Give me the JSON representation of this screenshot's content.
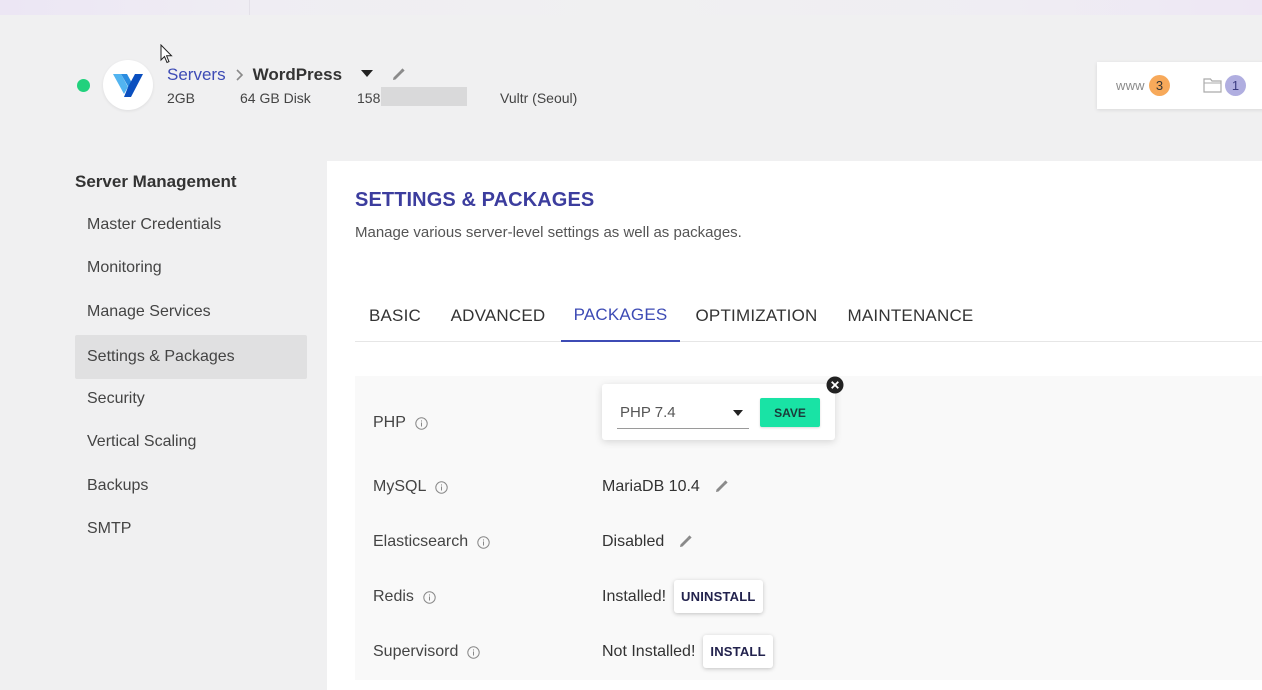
{
  "server": {
    "breadcrumb_root": "Servers",
    "name": "WordPress",
    "ram": "2GB",
    "disk": "64 GB Disk",
    "ip_prefix": "158.",
    "provider": "Vultr (Seoul)",
    "status_color": "#21d17d"
  },
  "top_widget": {
    "www_label": "www",
    "www_count": "3",
    "folder_count": "1"
  },
  "sidebar": {
    "title": "Server Management",
    "items": [
      {
        "label": "Master Credentials"
      },
      {
        "label": "Monitoring"
      },
      {
        "label": "Manage Services"
      },
      {
        "label": "Settings & Packages",
        "active": true
      },
      {
        "label": "Security"
      },
      {
        "label": "Vertical Scaling"
      },
      {
        "label": "Backups"
      },
      {
        "label": "SMTP"
      }
    ]
  },
  "page": {
    "title": "SETTINGS & PACKAGES",
    "subtitle": "Manage various server-level settings as well as packages."
  },
  "tabs": [
    {
      "label": "BASIC"
    },
    {
      "label": "ADVANCED"
    },
    {
      "label": "PACKAGES",
      "active": true
    },
    {
      "label": "OPTIMIZATION"
    },
    {
      "label": "MAINTENANCE"
    }
  ],
  "packages": {
    "php": {
      "label": "PHP",
      "selected": "PHP 7.4",
      "save_label": "SAVE"
    },
    "mysql": {
      "label": "MySQL",
      "value": "MariaDB 10.4"
    },
    "elasticsearch": {
      "label": "Elasticsearch",
      "value": "Disabled"
    },
    "redis": {
      "label": "Redis",
      "value": "Installed!",
      "action": "UNINSTALL"
    },
    "supervisord": {
      "label": "Supervisord",
      "value": "Not Installed!",
      "action": "INSTALL"
    }
  },
  "colors": {
    "accent": "#3d4bb5",
    "save_button": "#19e3a5",
    "www_badge": "#f7a95a",
    "folder_badge": "#b0aee0"
  }
}
